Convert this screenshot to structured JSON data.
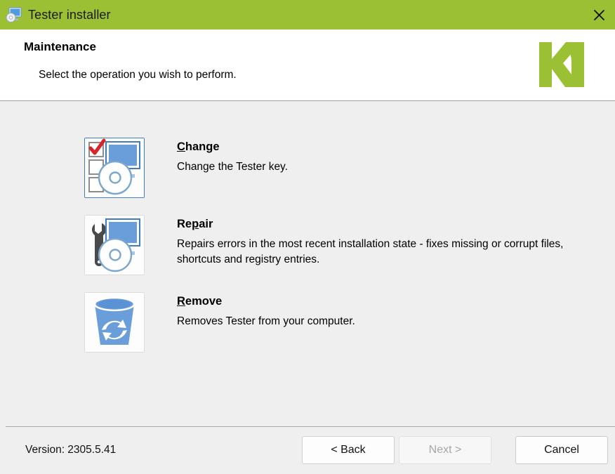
{
  "titlebar": {
    "title": "Tester installer",
    "icon": "monitor-disc-icon",
    "close_label": "✕",
    "background_color": "#9cc033"
  },
  "header": {
    "title": "Maintenance",
    "subtitle": "Select the operation you wish to perform.",
    "logo": "kofax-green-k-logo",
    "logo_color": "#9cc033"
  },
  "options": [
    {
      "id": "change",
      "title_accel": "C",
      "title_rest": "hange",
      "title": "Change",
      "description": "Change the Tester key.",
      "icon": "change-checkboxes-monitor-disc-icon",
      "selected": true
    },
    {
      "id": "repair",
      "title_pre": "Re",
      "title_accel": "p",
      "title_rest": "air",
      "title": "Repair",
      "description": "Repairs errors in the most recent installation state - fixes missing or corrupt files, shortcuts and registry entries.",
      "icon": "repair-wrench-monitor-disc-icon",
      "selected": false
    },
    {
      "id": "remove",
      "title_accel": "R",
      "title_rest": "emove",
      "title": "Remove",
      "description": "Removes Tester from your computer.",
      "icon": "remove-recycle-bin-icon",
      "selected": false
    }
  ],
  "footer": {
    "version_label": "Version: 2305.5.41",
    "buttons": {
      "back": "< Back",
      "next": "Next >",
      "cancel": "Cancel"
    },
    "next_enabled": false
  }
}
